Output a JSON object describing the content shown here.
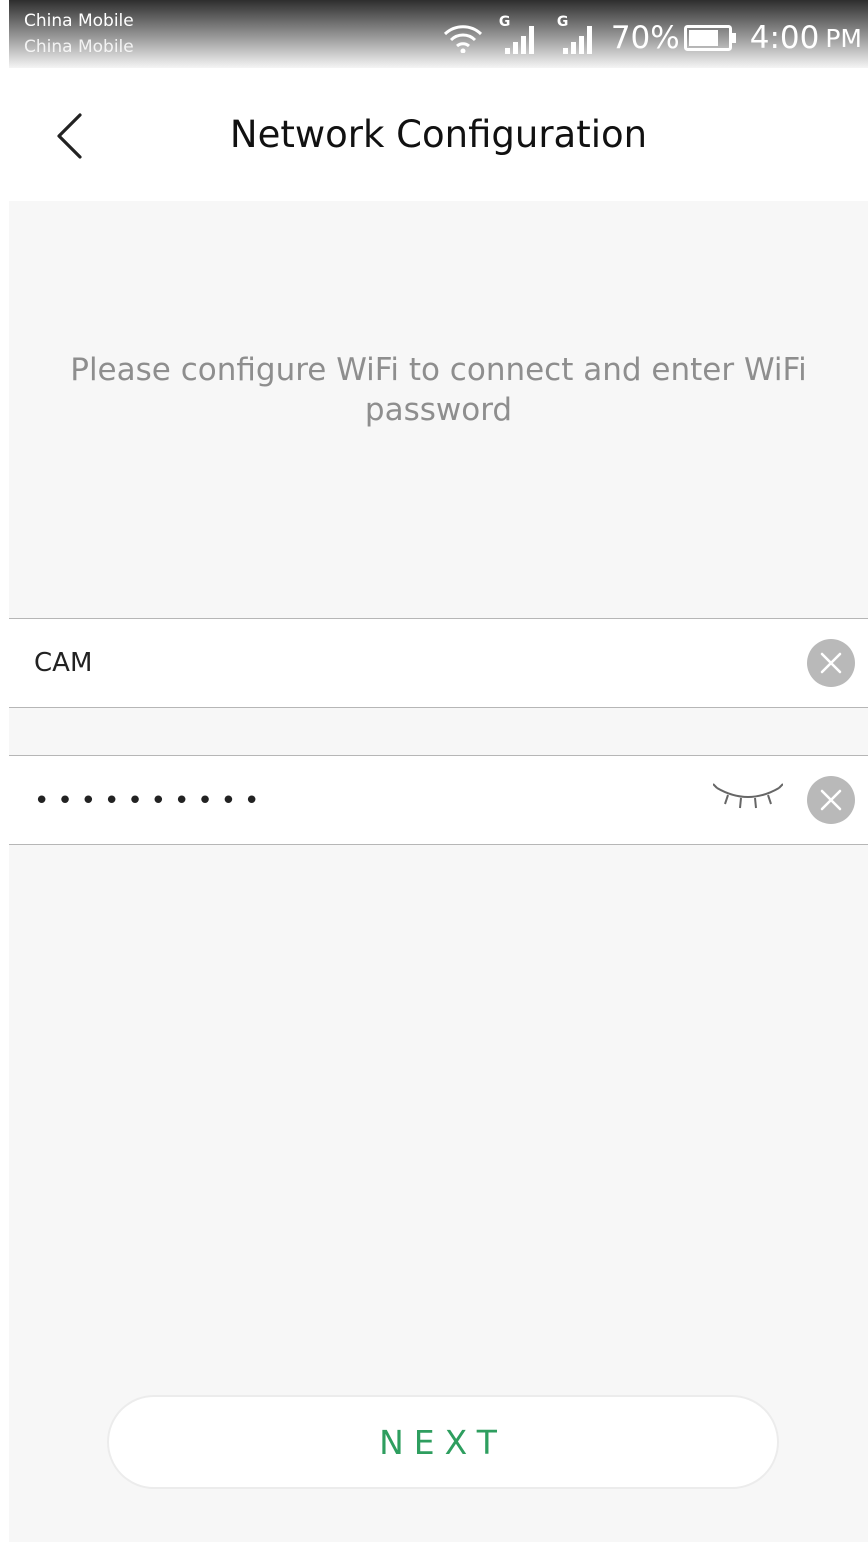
{
  "status_bar": {
    "carrier_1": "China Mobile",
    "carrier_2": "China Mobile",
    "network_type_1": "G",
    "network_type_2": "G",
    "battery": "70%",
    "time": "4:00",
    "ampm": "PM"
  },
  "header": {
    "title": "Network Configuration",
    "back_icon": "chevron-left-icon"
  },
  "instruction": "Please configure WiFi to connect and enter WiFi password",
  "wifi_form": {
    "ssid_value": "CAM",
    "password_masked": "••••••••••",
    "clear_icon": "close-circle-icon",
    "visibility_icon": "eye-closed-icon"
  },
  "next_button": {
    "label": "NEXT"
  },
  "colors": {
    "accent": "#2e9e5f",
    "background": "#f7f7f7",
    "muted_text": "#8e8e8e"
  }
}
